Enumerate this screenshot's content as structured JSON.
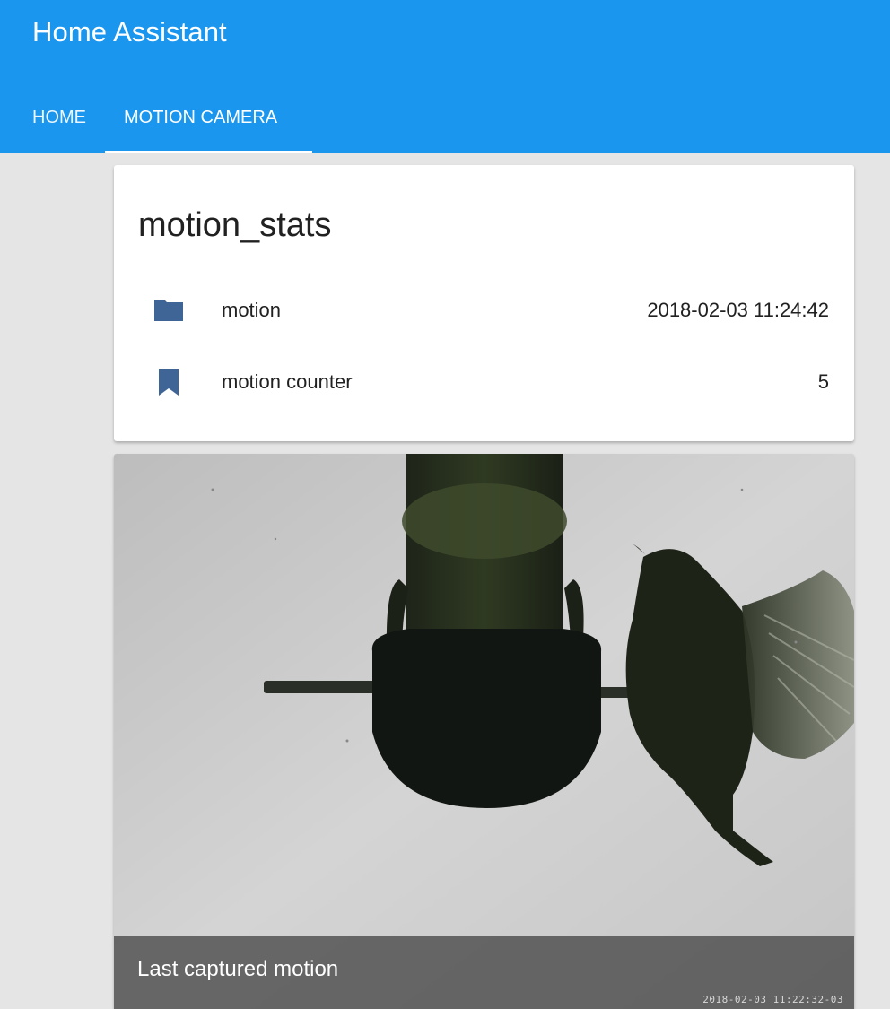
{
  "header": {
    "title": "Home Assistant",
    "tabs": [
      {
        "label": "HOME",
        "active": false
      },
      {
        "label": "MOTION CAMERA",
        "active": true
      }
    ],
    "color": "#1a96ef"
  },
  "stats_card": {
    "title": "motion_stats",
    "rows": [
      {
        "icon": "folder-icon",
        "label": "motion",
        "value": "2018-02-03 11:24:42"
      },
      {
        "icon": "bookmark-icon",
        "label": "motion counter",
        "value": "5"
      }
    ],
    "icon_color": "#3f6596"
  },
  "camera_card": {
    "caption": "Last captured motion",
    "overlay_timestamp": "2018-02-03 11:22:32-03"
  }
}
